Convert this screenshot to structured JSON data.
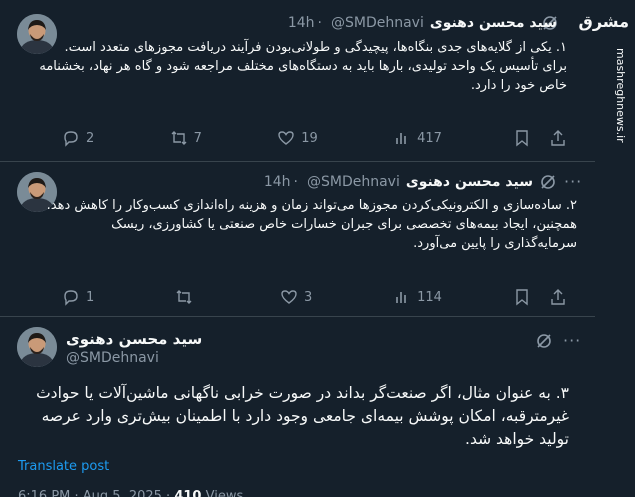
{
  "tweets": [
    {
      "author": "سید محسن دهنوی",
      "handle": "@SMDehnavi",
      "time": "14h",
      "text": [
        "۱. یکی از گلایه‌های جدی بنگاه‌ها، پیچیدگی و طولانی‌بودن فرآیند دریافت مجوزهای متعدد است.",
        "برای تأسیس یک واحد تولیدی، بارها باید به دستگاه‌های مختلف مراجعه شود و گاه هر نهاد، بخشنامه خاص خود را دارد."
      ],
      "replies": "2",
      "reposts": "7",
      "likes": "19",
      "views": "417"
    },
    {
      "author": "سید محسن دهنوی",
      "handle": "@SMDehnavi",
      "time": "14h",
      "text": [
        "۲. ساده‌سازی و الکترونیکی‌کردن مجوزها می‌تواند زمان و هزینه راه‌اندازی کسب‌وکار را کاهش دهد.",
        "همچنین، ایجاد بیمه‌های تخصصی برای جبران خسارات خاص صنعتی یا کشاورزی، ریسک سرمایه‌گذاری را پایین می‌آورد."
      ],
      "replies": "1",
      "reposts": "",
      "likes": "3",
      "views": "114"
    }
  ],
  "main_tweet": {
    "author": "سید محسن دهنوی",
    "handle": "@SMDehnavi",
    "text": "۳. به عنوان مثال، اگر صنعت‌گر بداند در صورت خرابی ناگهانی ماشین‌آلات یا حوادث غیرمترقبه، امکان پوشش بیمه‌ای جامعی وجود دارد با اطمینان بیش‌تری وارد عرصه تولید خواهد شد.",
    "translate": "Translate post",
    "meta_time": "6:16 PM · Aug 5, 2025 ·",
    "meta_views": "410",
    "meta_views_label": "Views"
  },
  "watermark": {
    "logo": "مشرق",
    "site": "mashreghnews.ir"
  },
  "icons": [
    "grok-icon",
    "more-icon",
    "reply-icon",
    "repost-icon",
    "like-icon",
    "views-icon",
    "bookmark-icon",
    "share-icon"
  ],
  "colors": {
    "background": "#15202b",
    "text": "#f7f9f9",
    "muted": "#8b98a5",
    "link": "#1d9bf0",
    "divider": "#38444d"
  }
}
